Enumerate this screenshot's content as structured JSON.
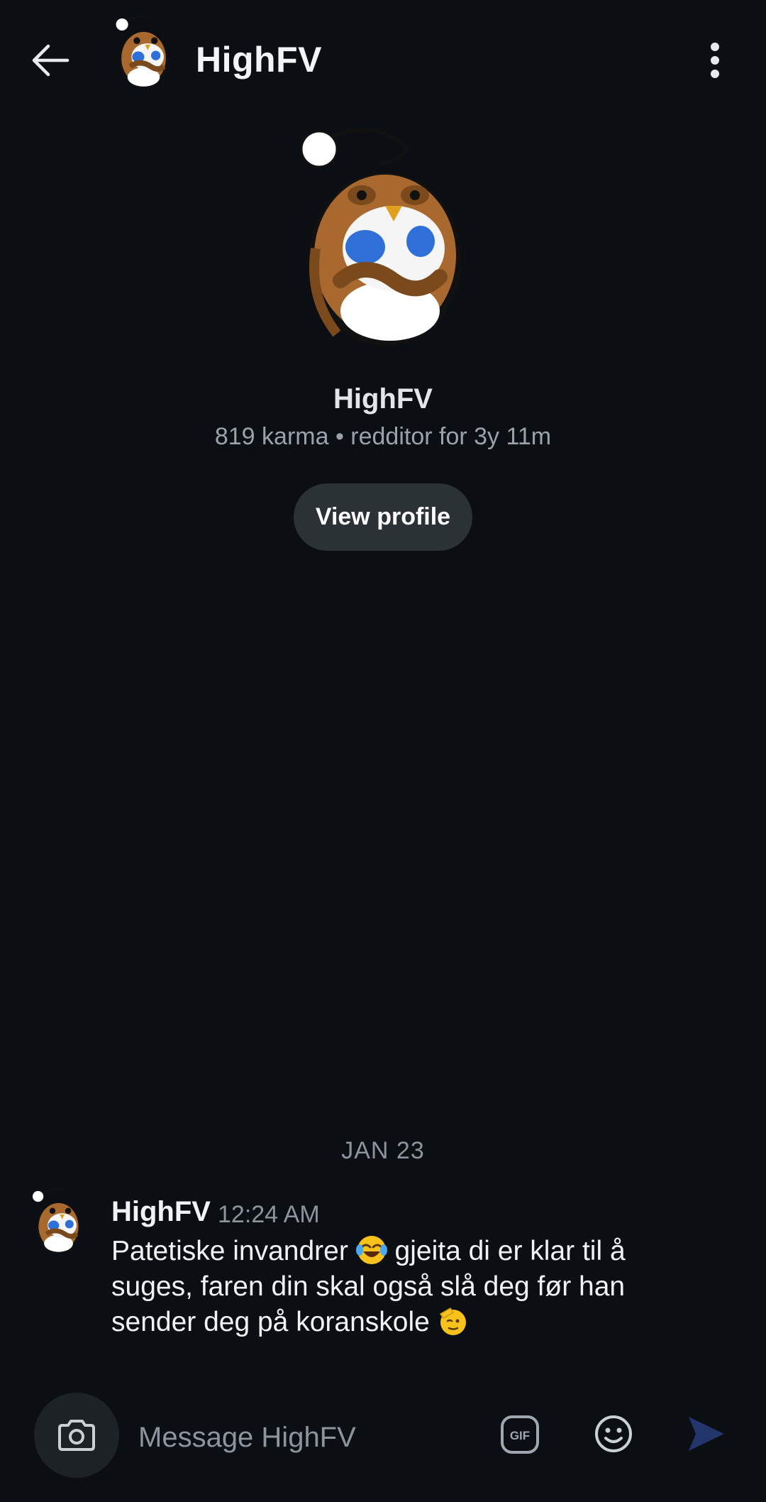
{
  "header": {
    "title": "HighFV",
    "back_icon": "arrow-left-icon",
    "more_icon": "more-vertical-icon"
  },
  "profile": {
    "name": "HighFV",
    "meta": "819 karma • redditor for 3y 11m",
    "view_profile_label": "View profile"
  },
  "conversation": {
    "date_separator": "JAN 23",
    "messages": [
      {
        "author": "HighFV",
        "time": "12:24 AM",
        "text_part1": "Patetiske invandrer ",
        "text_part2": " gjeita di er klar til å suges, faren din skal også slå deg før han sender deg på koranskole ",
        "emoji1": "face-with-tears-of-joy",
        "emoji2": "saluting-face"
      }
    ]
  },
  "composer": {
    "placeholder": "Message HighFV",
    "camera_icon": "camera-icon",
    "gif_label": "GIF",
    "emoji_icon": "smiley-icon",
    "send_icon": "send-icon"
  },
  "colors": {
    "background": "#0b0e12",
    "button_bg": "#2a3236",
    "muted_text": "#8c959d",
    "send_accent": "#23356b",
    "avatar_brown": "#a8682e",
    "avatar_blue": "#2f6fd8"
  }
}
